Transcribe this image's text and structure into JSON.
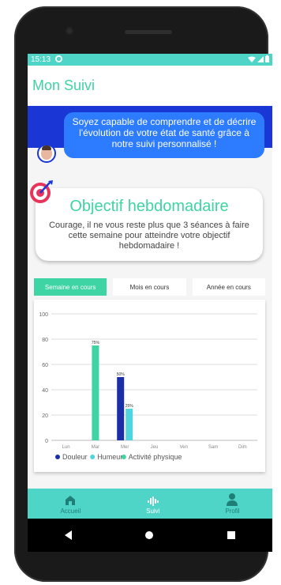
{
  "status_bar": {
    "time": "15:13",
    "app_indicator": "circle-icon",
    "icons": [
      "wifi-icon",
      "signal-icon",
      "battery-icon"
    ]
  },
  "app_bar": {
    "title": "Mon Suivi"
  },
  "banner": {
    "message": "Soyez capable de comprendre et de décrire l'évolution de votre état de santé grâce à notre suivi personnalisé !",
    "avatar": "avatar-photo"
  },
  "objective": {
    "title": "Objectif hebdomadaire",
    "text": "Courage, il ne vous reste plus que 3 séances à faire cette semaine pour atteindre votre objectif hebdomadaire !",
    "icon": "target-icon"
  },
  "tabs": [
    {
      "label": "Semaine en cours",
      "active": true
    },
    {
      "label": "Mois en cours",
      "active": false
    },
    {
      "label": "Année en cours",
      "active": false
    }
  ],
  "chart_data": {
    "type": "bar",
    "categories": [
      "Lun",
      "Mar",
      "Mer",
      "Jeu",
      "Ven",
      "Sam",
      "Dim"
    ],
    "ylim": [
      0,
      100
    ],
    "yticks": [
      0,
      20,
      40,
      60,
      80,
      100
    ],
    "grid": true,
    "legend_placement": "bottom",
    "series": [
      {
        "name": "Douleur",
        "color": "#1a2ea8",
        "values": [
          0,
          0,
          50,
          0,
          0,
          0,
          0
        ]
      },
      {
        "name": "Humeur",
        "color": "#4fd4e0",
        "values": [
          0,
          0,
          25,
          0,
          0,
          0,
          0
        ]
      },
      {
        "name": "Activité physique",
        "color": "#3ed4a3",
        "values": [
          0,
          75,
          0,
          0,
          0,
          0,
          0
        ]
      }
    ],
    "data_labels": [
      {
        "category": "Mar",
        "series": "Activité physique",
        "text": "75%"
      },
      {
        "category": "Mer",
        "series": "Douleur",
        "text": "50%"
      },
      {
        "category": "Mer",
        "series": "Humeur",
        "text": "25%"
      }
    ]
  },
  "bottom_nav": [
    {
      "label": "Accueil",
      "icon": "home-icon",
      "active": false
    },
    {
      "label": "Suivi",
      "icon": "chart-icon",
      "active": true
    },
    {
      "label": "Profil",
      "icon": "person-icon",
      "active": false
    }
  ],
  "colors": {
    "accent": "#3ed4a3",
    "status": "#4fd4c8",
    "banner": "#1a36d4",
    "bubble": "#2d7bff"
  }
}
